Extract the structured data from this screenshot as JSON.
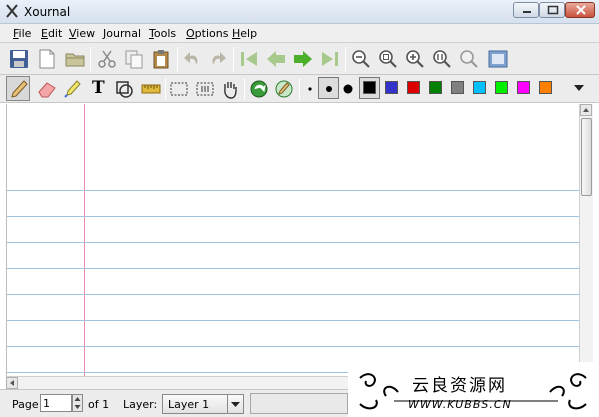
{
  "window": {
    "title": "Xournal"
  },
  "menubar": {
    "items": [
      {
        "label": "File",
        "underline": "F",
        "rest": "ile"
      },
      {
        "label": "Edit",
        "underline": "E",
        "rest": "dit"
      },
      {
        "label": "View",
        "underline": "V",
        "rest": "iew"
      },
      {
        "label": "Journal",
        "underline": "J",
        "rest": "ournal"
      },
      {
        "label": "Tools",
        "underline": "T",
        "rest": "ools"
      },
      {
        "label": "Options",
        "underline": "O",
        "rest": "ptions"
      },
      {
        "label": "Help",
        "underline": "H",
        "rest": "elp"
      }
    ]
  },
  "toolbar1": {
    "icons": [
      "save-icon",
      "new-page-icon",
      "open-folder-icon",
      "cut-icon",
      "copy-icon",
      "paste-icon",
      "undo-icon",
      "redo-icon",
      "first-page-icon",
      "previous-page-icon",
      "next-page-icon",
      "last-page-icon",
      "zoom-out-icon",
      "zoom-page-width-icon",
      "zoom-in-icon",
      "zoom-normal-icon",
      "zoom-set-icon",
      "fullscreen-icon"
    ]
  },
  "toolbar2": {
    "text_tool_glyph": "T",
    "colors": [
      "#000000",
      "#3333cc",
      "#dd0000",
      "#008000",
      "#808080",
      "#00c0ff",
      "#00ee00",
      "#ff00ff",
      "#ff8000"
    ],
    "selected_color": "#000000"
  },
  "statusbar": {
    "page_label": "Page",
    "page_value": "1",
    "of_label": "of 1",
    "layer_label": "Layer:",
    "layer_value": "Layer 1"
  },
  "watermark": {
    "chinese": "云良资源网",
    "url": "WWW.KUBBS.CN"
  }
}
